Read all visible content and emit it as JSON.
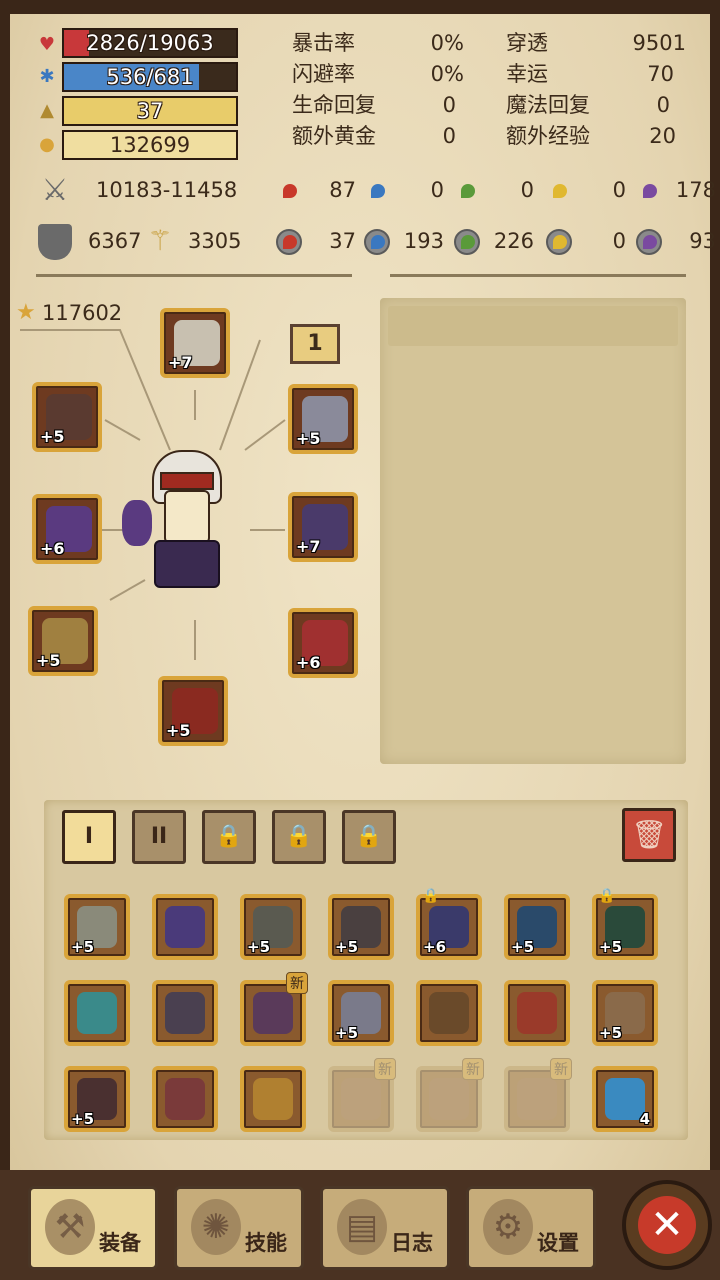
{
  "vitals": {
    "hp": {
      "text": "2826/19063",
      "fraction": 0.148,
      "color": "#c8383a",
      "icon": "heart-icon"
    },
    "mp": {
      "text": "536/681",
      "fraction": 0.787,
      "color": "#4a86c8",
      "icon": "mana-icon"
    },
    "level": {
      "text": "37",
      "fraction": 1.0,
      "color": "#e8cc6a",
      "icon": "level-triangle-icon"
    },
    "gold": {
      "text": "132699",
      "fraction": 0,
      "color": "#e8cc6a",
      "icon": "gold-coin-icon"
    }
  },
  "stats": [
    {
      "label": "暴击率",
      "value": "0%"
    },
    {
      "label": "穿透",
      "value": "9501"
    },
    {
      "label": "闪避率",
      "value": "0%"
    },
    {
      "label": "幸运",
      "value": "70"
    },
    {
      "label": "生命回复",
      "value": "0"
    },
    {
      "label": "魔法回复",
      "value": "0"
    },
    {
      "label": "额外黄金",
      "value": "0"
    },
    {
      "label": "额外经验",
      "value": "20"
    }
  ],
  "combat": {
    "attack": "10183-11458",
    "defense": "6367",
    "magic": "3305"
  },
  "elements_attack": [
    {
      "icon": "fire-drop-icon",
      "value": "87",
      "color": "#c8382a"
    },
    {
      "icon": "water-drop-icon",
      "value": "0",
      "color": "#3a78c0"
    },
    {
      "icon": "leaf-icon",
      "value": "0",
      "color": "#5a9a3a"
    },
    {
      "icon": "lightning-icon",
      "value": "0",
      "color": "#e0b830"
    },
    {
      "icon": "dark-swirl-icon",
      "value": "178",
      "color": "#7a4aa0"
    }
  ],
  "elements_resist": [
    {
      "icon": "fire-shield-icon",
      "value": "37",
      "color": "#c8382a"
    },
    {
      "icon": "water-shield-icon",
      "value": "193",
      "color": "#3a78c0"
    },
    {
      "icon": "leaf-shield-icon",
      "value": "226",
      "color": "#5a9a3a"
    },
    {
      "icon": "lightning-shield-icon",
      "value": "0",
      "color": "#e0b830"
    },
    {
      "icon": "dark-shield-icon",
      "value": "93",
      "color": "#7a4aa0"
    }
  ],
  "power": "117602",
  "set_tag": "1",
  "equipped": [
    {
      "name": "helmet",
      "level": "+7",
      "color": "#c8c0b0"
    },
    {
      "name": "shoulder",
      "level": "+5",
      "color": "#5a3a30"
    },
    {
      "name": "amulet",
      "level": "+5",
      "color": "#8a8a9a"
    },
    {
      "name": "weapon",
      "level": "+6",
      "color": "#5a3a80"
    },
    {
      "name": "armor",
      "level": "+7",
      "color": "#4a3a6a"
    },
    {
      "name": "gloves",
      "level": "+5",
      "color": "#a08040"
    },
    {
      "name": "pants",
      "level": "+6",
      "color": "#a03030"
    },
    {
      "name": "boots",
      "level": "+5",
      "color": "#8a2a20"
    }
  ],
  "bag_tabs": [
    "I",
    "II",
    "lock",
    "lock",
    "lock"
  ],
  "inventory": [
    [
      {
        "level": "+5",
        "color": "#8a8a7a",
        "lock": false,
        "new": false,
        "faded": false
      },
      {
        "level": "",
        "color": "#4a3a7a",
        "lock": false,
        "new": false,
        "faded": false
      },
      {
        "level": "+5",
        "color": "#5a5a50",
        "lock": false,
        "new": false,
        "faded": false
      },
      {
        "level": "+5",
        "color": "#4a4040",
        "lock": false,
        "new": false,
        "faded": false
      },
      {
        "level": "+6",
        "color": "#3a3a6a",
        "lock": true,
        "new": false,
        "faded": false
      },
      {
        "level": "+5",
        "color": "#2a4a6a",
        "lock": false,
        "new": false,
        "faded": false
      },
      {
        "level": "+5",
        "color": "#2a4a3a",
        "lock": true,
        "new": false,
        "faded": false
      }
    ],
    [
      {
        "level": "",
        "color": "#3a8a8a",
        "lock": false,
        "new": false,
        "faded": false
      },
      {
        "level": "",
        "color": "#4a4050",
        "lock": false,
        "new": false,
        "faded": false
      },
      {
        "level": "",
        "color": "#5a3a5a",
        "lock": false,
        "new": true,
        "faded": false
      },
      {
        "level": "+5",
        "color": "#7a7a8a",
        "lock": false,
        "new": false,
        "faded": false
      },
      {
        "level": "",
        "color": "#6a4a2a",
        "lock": false,
        "new": false,
        "faded": false
      },
      {
        "level": "",
        "color": "#9a3a2a",
        "lock": false,
        "new": false,
        "faded": false
      },
      {
        "level": "+5",
        "color": "#8a6a4a",
        "lock": false,
        "new": false,
        "faded": false
      }
    ],
    [
      {
        "level": "+5",
        "color": "#4a3030",
        "lock": false,
        "new": false,
        "faded": false
      },
      {
        "level": "",
        "color": "#7a3a3a",
        "lock": false,
        "new": false,
        "faded": false
      },
      {
        "level": "",
        "color": "#b08030",
        "lock": false,
        "new": false,
        "faded": false
      },
      {
        "level": "",
        "color": "#8a5a3a",
        "lock": false,
        "new": true,
        "faded": true
      },
      {
        "level": "",
        "color": "#8a5a3a",
        "lock": false,
        "new": true,
        "faded": true
      },
      {
        "level": "",
        "color": "#8a5a3a",
        "lock": false,
        "new": true,
        "faded": true
      },
      {
        "level": "4",
        "color": "#3a8ac0",
        "lock": false,
        "new": false,
        "faded": false
      }
    ]
  ],
  "new_label": "新",
  "nav": [
    {
      "label": "装备",
      "icon": "axe-icon"
    },
    {
      "label": "技能",
      "icon": "skill-gear-icon"
    },
    {
      "label": "日志",
      "icon": "journal-icon"
    },
    {
      "label": "设置",
      "icon": "settings-gear-icon"
    }
  ],
  "close_label": "✕"
}
